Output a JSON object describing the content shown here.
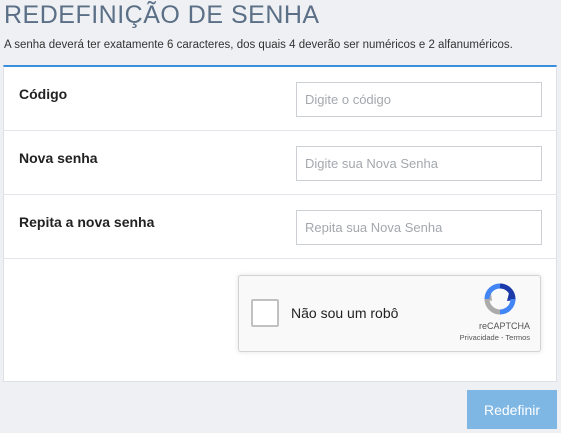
{
  "header": {
    "title": "REDEFINIÇÃO DE SENHA",
    "subtitle": "A senha deverá ter exatamente 6 caracteres, dos quais 4 deverão ser numéricos e 2 alfanuméricos."
  },
  "form": {
    "fields": [
      {
        "label": "Código",
        "placeholder": "Digite o código",
        "value": ""
      },
      {
        "label": "Nova senha",
        "placeholder": "Digite sua Nova Senha",
        "value": ""
      },
      {
        "label": "Repita a nova senha",
        "placeholder": "Repita sua Nova Senha",
        "value": ""
      }
    ]
  },
  "recaptcha": {
    "label": "Não sou um robô",
    "brand": "reCAPTCHA",
    "privacy": "Privacidade",
    "separator": " - ",
    "terms": "Termos",
    "icon": "recaptcha-logo-icon",
    "checked": false
  },
  "actions": {
    "submit_label": "Redefinir"
  },
  "colors": {
    "title": "#5b6f86",
    "accent_border": "#3c8ddc",
    "button_bg": "#7eb6e4",
    "page_bg": "#eef0f3"
  }
}
